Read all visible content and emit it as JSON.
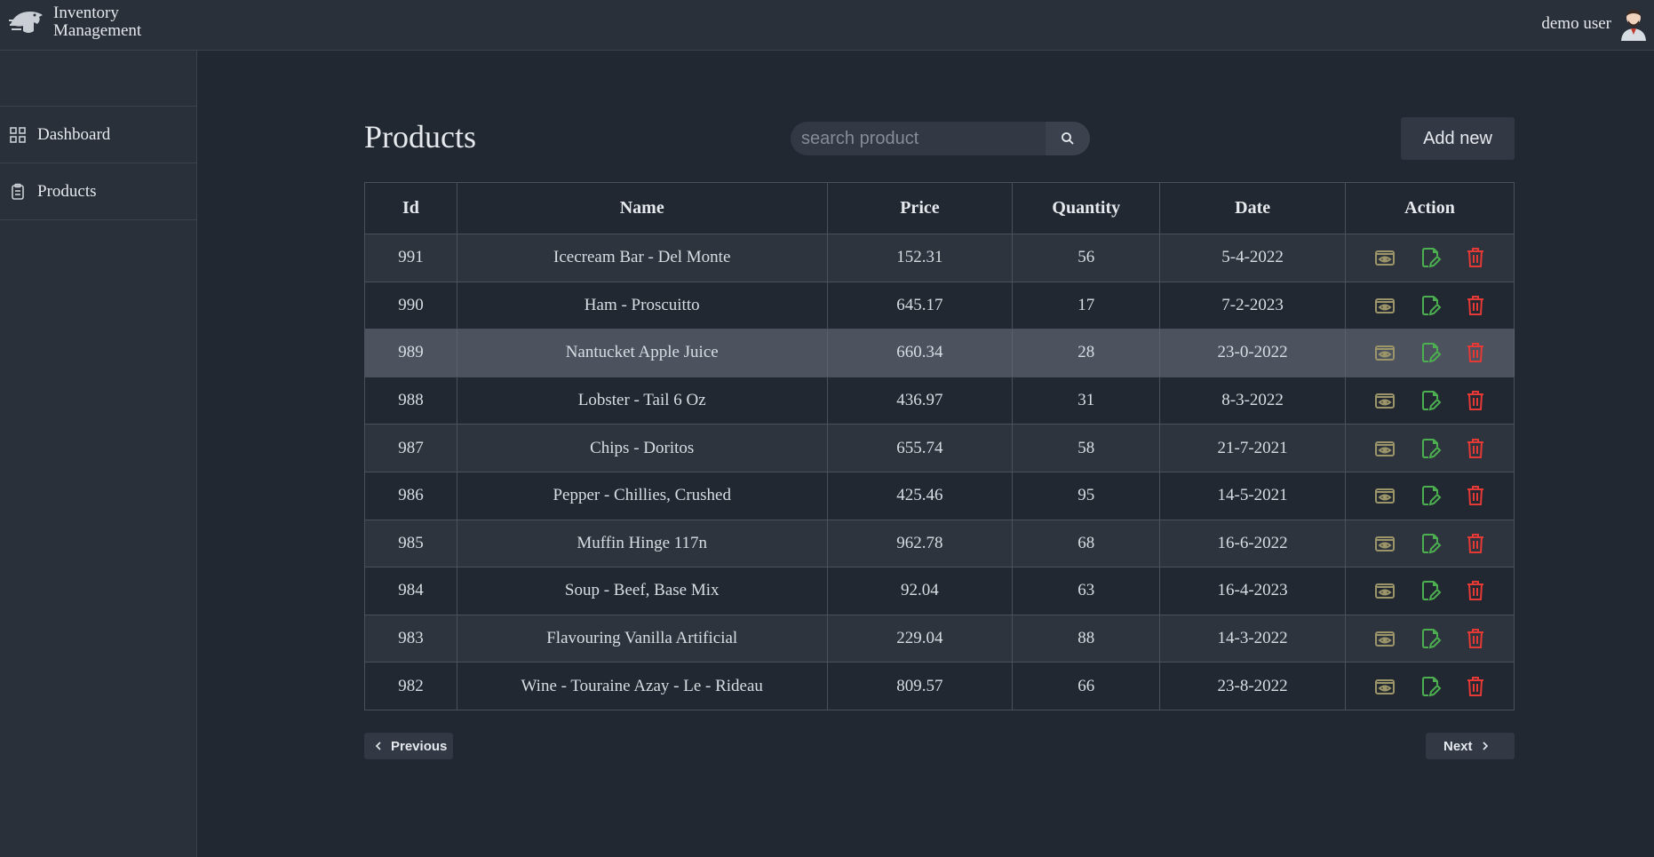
{
  "header": {
    "brand_line1": "Inventory",
    "brand_line2": "Management",
    "user_name": "demo user"
  },
  "sidebar": {
    "items": [
      {
        "label": "Dashboard",
        "icon": "grid-icon"
      },
      {
        "label": "Products",
        "icon": "clipboard-icon"
      }
    ]
  },
  "main": {
    "title": "Products",
    "search_placeholder": "search product",
    "search_value": "",
    "add_label": "Add new"
  },
  "table": {
    "columns": [
      "Id",
      "Name",
      "Price",
      "Quantity",
      "Date",
      "Action"
    ],
    "rows": [
      {
        "id": "991",
        "name": "Icecream Bar - Del Monte",
        "price": "152.31",
        "quantity": "56",
        "date": "5-4-2022"
      },
      {
        "id": "990",
        "name": "Ham - Proscuitto",
        "price": "645.17",
        "quantity": "17",
        "date": "7-2-2023"
      },
      {
        "id": "989",
        "name": "Nantucket Apple Juice",
        "price": "660.34",
        "quantity": "28",
        "date": "23-0-2022"
      },
      {
        "id": "988",
        "name": "Lobster - Tail 6 Oz",
        "price": "436.97",
        "quantity": "31",
        "date": "8-3-2022"
      },
      {
        "id": "987",
        "name": "Chips - Doritos",
        "price": "655.74",
        "quantity": "58",
        "date": "21-7-2021"
      },
      {
        "id": "986",
        "name": "Pepper - Chillies, Crushed",
        "price": "425.46",
        "quantity": "95",
        "date": "14-5-2021"
      },
      {
        "id": "985",
        "name": "Muffin Hinge 117n",
        "price": "962.78",
        "quantity": "68",
        "date": "16-6-2022"
      },
      {
        "id": "984",
        "name": "Soup - Beef, Base Mix",
        "price": "92.04",
        "quantity": "63",
        "date": "16-4-2023"
      },
      {
        "id": "983",
        "name": "Flavouring Vanilla Artificial",
        "price": "229.04",
        "quantity": "88",
        "date": "14-3-2022"
      },
      {
        "id": "982",
        "name": "Wine - Touraine Azay - Le - Rideau",
        "price": "809.57",
        "quantity": "66",
        "date": "23-8-2022"
      }
    ],
    "hovered_row_id": "989"
  },
  "pager": {
    "previous_label": "Previous",
    "next_label": "Next"
  },
  "colors": {
    "view_icon": "#9c9569",
    "edit_icon": "#4caf50",
    "delete_icon": "#e53935"
  }
}
